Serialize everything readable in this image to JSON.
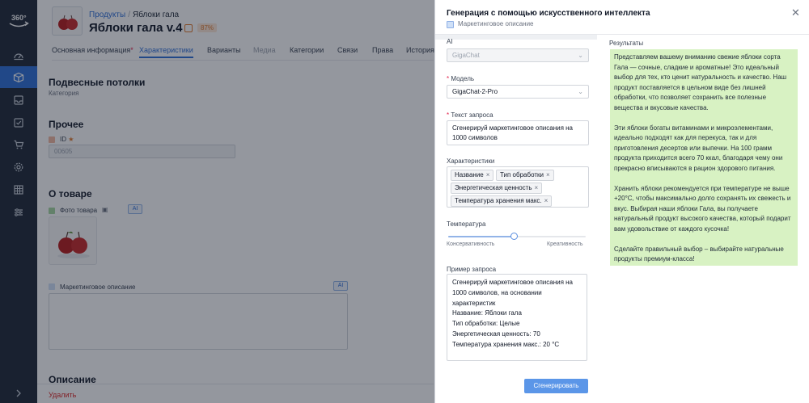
{
  "nav": {
    "logo_text": "360°",
    "items": [
      {
        "icon": "monitor-icon"
      },
      {
        "icon": "box-icon",
        "active": true
      },
      {
        "icon": "inbox-icon"
      },
      {
        "icon": "checklist-icon"
      },
      {
        "icon": "cart-icon"
      },
      {
        "icon": "gear-icon"
      },
      {
        "icon": "grid-icon"
      },
      {
        "icon": "sliders-icon"
      }
    ],
    "expand_icon": "chevron-right-icon"
  },
  "page": {
    "breadcrumb": {
      "root": "Продукты",
      "separator": "/",
      "current": "Яблоки гала"
    },
    "title": "Яблоки гала v.4",
    "completeness": "87%",
    "tabs": [
      {
        "label": "Основная информация",
        "required": "*"
      },
      {
        "label": "Характеристики",
        "active": true
      },
      {
        "label": "Варианты"
      },
      {
        "label": "Медиа",
        "muted": true
      },
      {
        "label": "Категории"
      },
      {
        "label": "Связи"
      },
      {
        "label": "Права"
      },
      {
        "label": "История"
      }
    ],
    "sections": {
      "hanging_ceilings": {
        "title": "Подвесные потолки",
        "subtitle": "Категория"
      },
      "other": {
        "title": "Прочее",
        "id_label": "ID",
        "id_value": "00605"
      },
      "about": {
        "title": "О товаре",
        "photo_label": "Фото товара",
        "ai_label": "AI",
        "marketing_label": "Маркетинговое описание",
        "marketing_ai_label": "AI"
      },
      "next": {
        "title": "Описание"
      }
    },
    "delete_label": "Удалить"
  },
  "modal": {
    "title": "Генерация с помощью искусственного интеллекта",
    "subtitle": "Маркетинговое описание",
    "ai": {
      "label": "AI",
      "value": "GigaChat"
    },
    "model": {
      "label": "Модель",
      "required": "*",
      "value": "GigaChat-2-Pro"
    },
    "prompt": {
      "label": "Текст запроса",
      "required": "*",
      "value": "Сгенерируй маркетинговое описания на 1000 символов"
    },
    "characteristics": {
      "label": "Характеристики",
      "chips": [
        "Название",
        "Тип обработки",
        "Энергетическая ценность",
        "Температура хранения макс."
      ]
    },
    "temperature": {
      "label": "Температура",
      "min_label": "Консервативность",
      "max_label": "Креативность",
      "value": 0.48
    },
    "example": {
      "label": "Пример запроса",
      "lines": [
        "Сгенерируй маркетинговое описания на",
        "1000 символов, на основании",
        "характеристик",
        "Название: Яблоки гала",
        "Тип обработки: Целые",
        "Энергетическая ценность: 70",
        "Температура хранения макс.: 20 °C"
      ]
    },
    "results": {
      "label": "Результаты",
      "paragraphs": [
        "Представляем вашему вниманию свежие яблоки сорта Гала — сочные, сладкие и ароматные! Это идеальный выбор для тех, кто ценит натуральность и качество. Наш продукт поставляется в цельном виде без лишней обработки, что позволяет сохранить все полезные вещества и вкусовые качества.",
        "Эти яблоки богаты витаминами и микроэлементами, идеально подходят как для перекуса, так и для приготовления десертов или выпечки. На 100 грамм продукта приходится всего 70 ккал, благодаря чему они прекрасно вписываются в рацион здорового питания.",
        "Хранить яблоки рекомендуется при температуре не выше +20°C, чтобы максимально долго сохранять их свежесть и вкус. Выбирая наши яблоки Гала, вы получаете натуральный продукт высокого качества, который подарит вам удовольствие от каждого кусочка!",
        "Сделайте правильный выбор – выбирайте натуральные продукты премиум-класса!"
      ]
    },
    "generate_label": "Сгенерировать",
    "colors": {
      "accent": "#2f6fd8",
      "results_bg": "#d8f2c3",
      "button": "#5b96e8"
    }
  }
}
